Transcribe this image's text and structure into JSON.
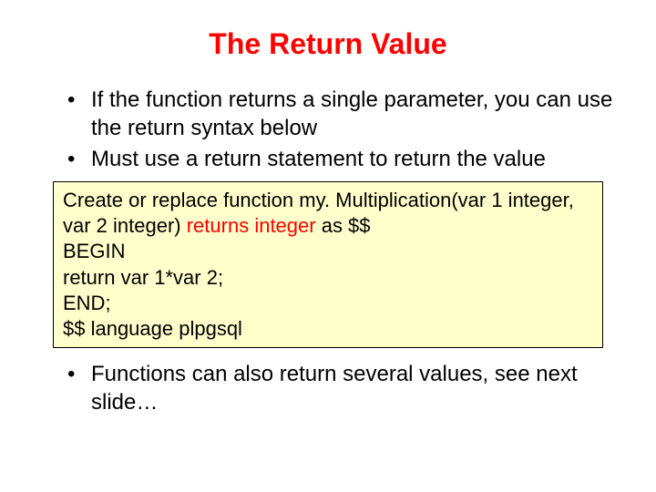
{
  "title": "The Return Value",
  "bullets_top": [
    "If the function returns a single parameter, you can use the return syntax below",
    "Must use a return statement to return the value"
  ],
  "code": {
    "l1a": "Create or replace function my. Multiplication(var 1 integer, var 2 integer) ",
    "l1b": "returns integer",
    "l1c": " as $$",
    "l2": "BEGIN",
    "l3": "return var 1*var 2;",
    "l4": "END;",
    "l5": "$$ language plpgsql"
  },
  "bullets_bottom": [
    "Functions can also return several values, see next slide…"
  ]
}
